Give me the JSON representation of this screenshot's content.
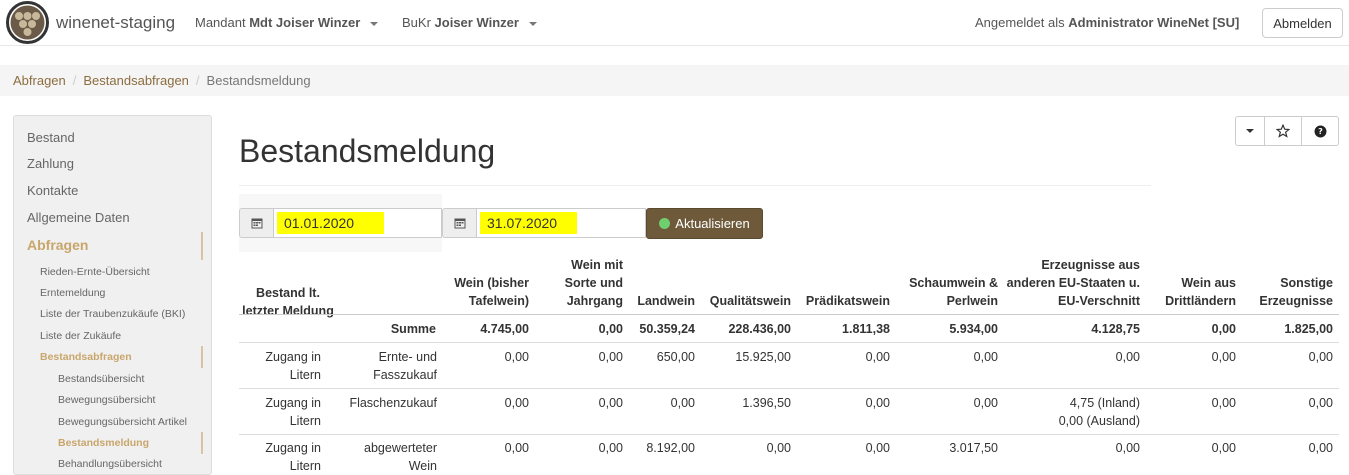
{
  "navbar": {
    "brand": "winenet-staging",
    "mandant_label": "Mandant",
    "mandant_value": "Mdt Joiser Winzer",
    "bukr_label": "BuKr",
    "bukr_value": "Joiser Winzer",
    "login_label": "Angemeldet als",
    "login_user": "Administrator WineNet [SU]",
    "logout": "Abmelden"
  },
  "breadcrumb": [
    "Abfragen",
    "Bestandsabfragen",
    "Bestandsmeldung"
  ],
  "sidebar": {
    "items": [
      "Bestand",
      "Zahlung",
      "Kontakte",
      "Allgemeine Daten",
      "Abfragen"
    ],
    "sub": [
      "Rieden-Ernte-Übersicht",
      "Erntemeldung",
      "Liste der Traubenzukäufe (BKI)",
      "Liste der Zukäufe",
      "Bestandsabfragen"
    ],
    "sub2": [
      "Bestandsübersicht",
      "Bewegungsübersicht",
      "Bewegungsübersicht Artikel",
      "Bestandsmeldung",
      "Behandlungsübersicht"
    ]
  },
  "page": {
    "title": "Bestandsmeldung",
    "date_from": "01.01.2020",
    "date_to": "31.07.2020",
    "refresh": "Aktualisieren"
  },
  "table": {
    "headers": [
      "Bestand lt. letzter Meldung",
      "Summe",
      "Wein (bisher Tafelwein)",
      "Wein mit Sorte und Jahrgang",
      "Landwein",
      "Qualitätswein",
      "Prädikatswein",
      "Schaumwein & Perlwein",
      "Erzeugnisse aus anderen EU-Staaten u. EU-Verschnitt",
      "Wein aus Drittländern",
      "Sonstige Erzeugnisse"
    ],
    "sum_row": [
      "4.745,00",
      "0,00",
      "50.359,24",
      "228.436,00",
      "1.811,38",
      "5.934,00",
      "4.128,75",
      "0,00",
      "1.825,00"
    ],
    "rows": [
      {
        "type": "Zugang in Litern",
        "desc": "Ernte- und Fasszukauf",
        "values": [
          "0,00",
          "0,00",
          "650,00",
          "15.925,00",
          "0,00",
          "0,00",
          "0,00",
          "0,00",
          "0,00"
        ]
      },
      {
        "type": "Zugang in Litern",
        "desc": "Flaschenzukauf",
        "values": [
          "0,00",
          "0,00",
          "0,00",
          "1.396,50",
          "0,00",
          "0,00",
          "4,75 (Inland)\n0,00 (Ausland)",
          "0,00",
          "0,00"
        ]
      },
      {
        "type": "Zugang in Litern",
        "desc": "abgewerteter Wein",
        "values": [
          "0,00",
          "0,00",
          "8.192,00",
          "0,00",
          "0,00",
          "3.017,50",
          "0,00",
          "0,00",
          "0,00"
        ]
      }
    ]
  }
}
